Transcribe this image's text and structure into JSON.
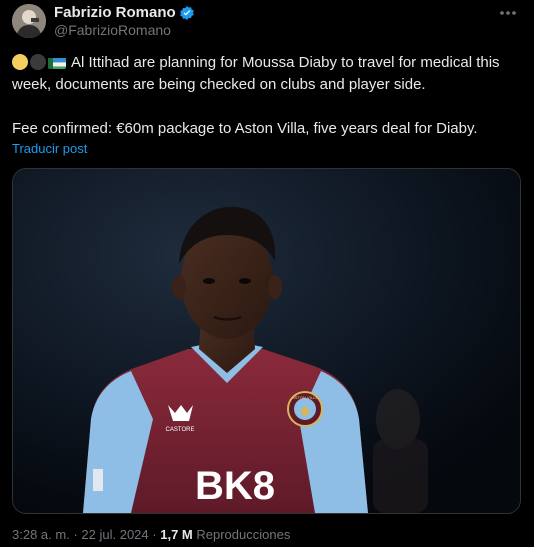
{
  "author": {
    "display_name": "Fabrizio Romano",
    "handle": "@FabrizioRomano",
    "verified": true,
    "avatar_icon": "profile-photo"
  },
  "menu_icon": "more-dots-icon",
  "tweet": {
    "line1": "Al Ittihad are planning for Moussa Diaby to travel for medical this week, documents are being checked on clubs and player side.",
    "line2": "Fee confirmed: €60m package to Aston Villa, five years deal for Diaby.",
    "emojis": [
      "yellow-circle",
      "black-circle",
      "flag"
    ],
    "translate_label": "Traducir post"
  },
  "media": {
    "description_icon": "player-photo",
    "kit_sponsor": "BK8",
    "kit_brand": "CASTORE",
    "crest_text": "ASTON VILLA"
  },
  "footer": {
    "time": "3:28 a. m.",
    "separator": "·",
    "date": "22 jul. 2024",
    "views_count": "1,7 M",
    "views_label": "Reproducciones"
  },
  "colors": {
    "background": "#000000",
    "text": "#e7e9ea",
    "secondary": "#71767b",
    "link": "#1d9bf0",
    "verified": "#1d9bf0",
    "kit_claret": "#7a2434",
    "kit_blue": "#8ebde6"
  }
}
